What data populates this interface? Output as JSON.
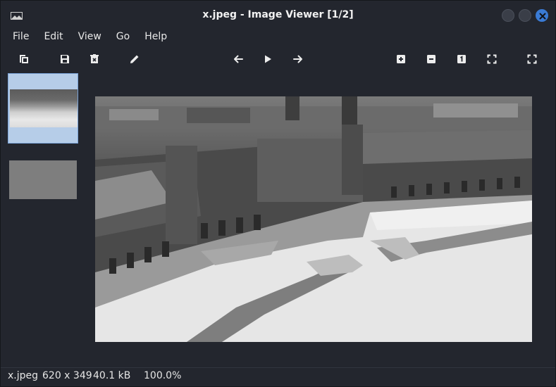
{
  "window": {
    "title": "x.jpeg - Image Viewer [1/2]",
    "accent_color": "#3a7bd5",
    "background_color": "#23262e"
  },
  "menu": [
    "File",
    "Edit",
    "View",
    "Go",
    "Help"
  ],
  "toolbar": {
    "icons": [
      "copy-icon",
      "save-icon",
      "delete-icon",
      "edit-icon",
      "previous-icon",
      "slideshow-play-icon",
      "next-icon",
      "zoom-in-icon",
      "zoom-out-icon",
      "actual-size-icon",
      "fit-to-window-icon",
      "fullscreen-icon"
    ]
  },
  "thumbnails": [
    {
      "selected": true
    },
    {
      "selected": false
    }
  ],
  "status": {
    "filename": "x.jpeg",
    "dimensions": "620 x 349",
    "filesize": "40.1 kB",
    "zoom": "100.0%"
  }
}
